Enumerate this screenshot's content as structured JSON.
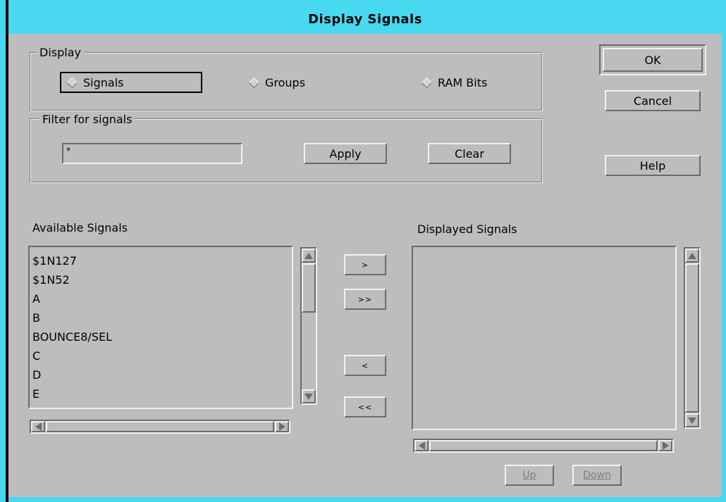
{
  "window": {
    "title": "Display Signals"
  },
  "display_group": {
    "label": "Display",
    "options": [
      {
        "label": "Signals",
        "selected": true
      },
      {
        "label": "Groups",
        "selected": false
      },
      {
        "label": "RAM Bits",
        "selected": false
      }
    ]
  },
  "filter_group": {
    "label": "Filter for signals",
    "value": "*",
    "apply_label": "Apply",
    "clear_label": "Clear"
  },
  "dialog_buttons": {
    "ok": "OK",
    "cancel": "Cancel",
    "help": "Help"
  },
  "available": {
    "label": "Available Signals",
    "items": [
      "$1N127",
      "$1N52",
      "A",
      "B",
      "BOUNCE8/SEL",
      "C",
      "D",
      "E"
    ]
  },
  "transfer": {
    "add": ">",
    "add_all": ">>",
    "remove": "<",
    "remove_all": "<<"
  },
  "displayed": {
    "label": "Displayed Signals",
    "items": []
  },
  "order": {
    "up": "Up",
    "down": "Down"
  },
  "icons": {
    "radio": "diamond-radio-icon",
    "scroll_up": "arrow-up-icon",
    "scroll_down": "arrow-down-icon",
    "scroll_left": "arrow-left-icon",
    "scroll_right": "arrow-right-icon"
  },
  "colors": {
    "title_bar": "#48d9f0",
    "dialog_bg": "#bdbdbd"
  }
}
